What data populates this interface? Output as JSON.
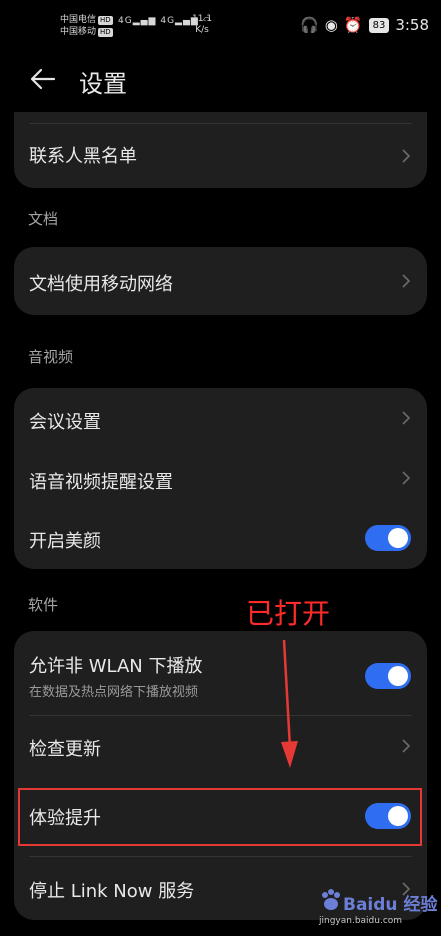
{
  "status_bar": {
    "carrier1": "中国电信",
    "carrier2": "中国移动",
    "hd": "HD",
    "net1": "4G",
    "net2": "4G",
    "speed_value": "11.1",
    "speed_unit": "K/s",
    "battery": "83",
    "time": "3:58"
  },
  "header": {
    "title": "设置"
  },
  "sections": {
    "blacklist_row": "联系人黑名单",
    "doc_label": "文档",
    "doc_mobile_row": "文档使用移动网络",
    "av_label": "音视频",
    "meeting_settings": "会议设置",
    "av_reminder": "语音视频提醒设置",
    "beauty": "开启美颜",
    "software_label": "软件",
    "non_wlan": "允许非 WLAN 下播放",
    "non_wlan_sub": "在数据及热点网络下播放视频",
    "check_update": "检查更新",
    "experience": "体验提升",
    "stop_linknow": "停止 Link Now 服务"
  },
  "toggles": {
    "beauty": true,
    "non_wlan": true,
    "experience": true
  },
  "annotation": {
    "text": "已打开"
  },
  "watermark": {
    "brand": "Baidu 经验",
    "url": "jingyan.baidu.com"
  },
  "colors": {
    "accent": "#2f6ef0",
    "annotation": "#e53935"
  }
}
